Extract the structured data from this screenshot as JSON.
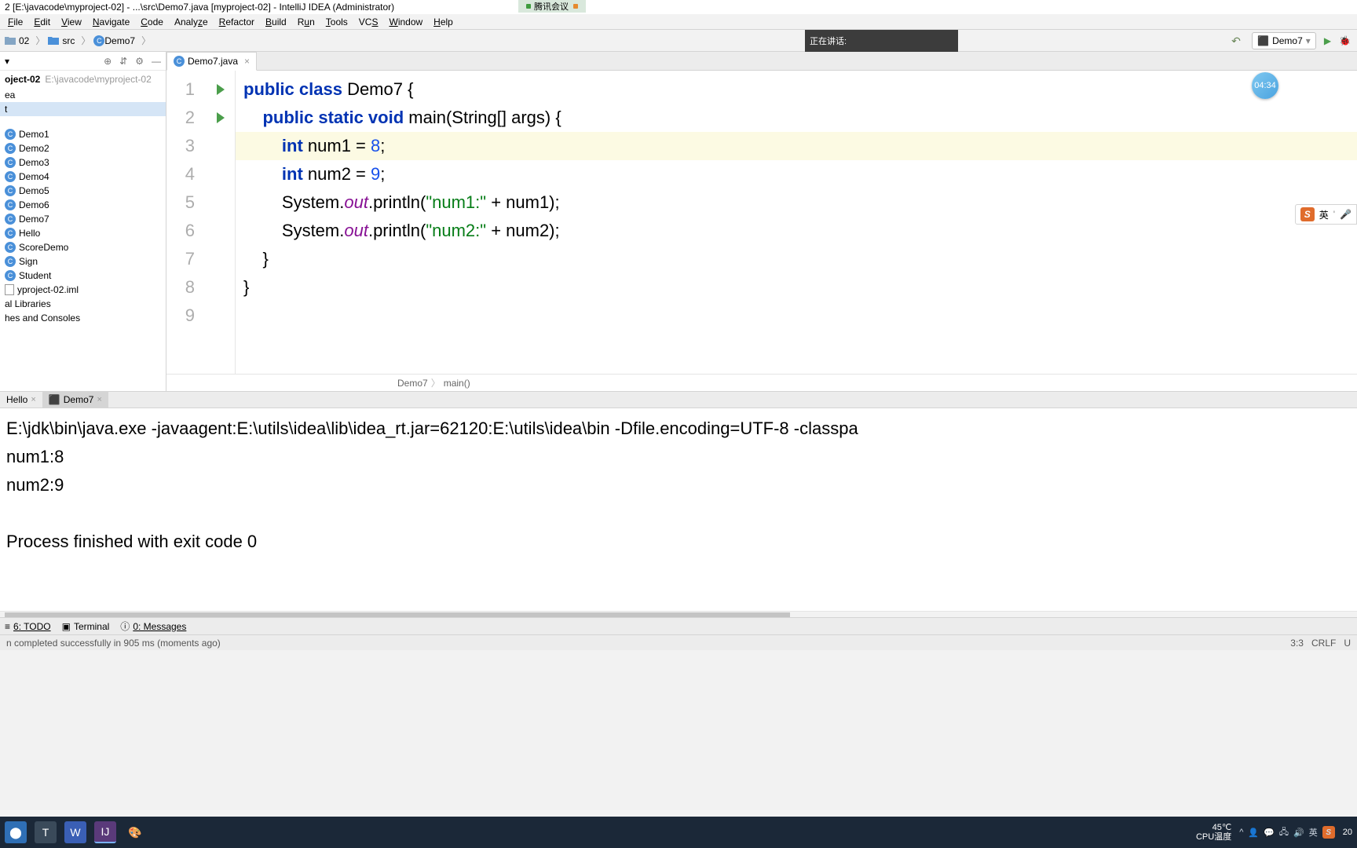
{
  "title_bar": {
    "title": "2 [E:\\javacode\\myproject-02] - ...\\src\\Demo7.java [myproject-02] - IntelliJ IDEA (Administrator)",
    "tencent": "腾讯会议"
  },
  "menu": {
    "file": "File",
    "edit": "Edit",
    "view": "View",
    "navigate": "Navigate",
    "code": "Code",
    "analyze": "Analyze",
    "refactor": "Refactor",
    "build": "Build",
    "run": "Run",
    "tools": "Tools",
    "vcs": "VCS",
    "window": "Window",
    "help": "Help"
  },
  "nav": {
    "crumb1": "02",
    "crumb2": "src",
    "crumb3": "Demo7",
    "talking": "正在讲话:",
    "run_config": "Demo7"
  },
  "sidebar": {
    "header_name": "oject-02",
    "header_path": "E:\\javacode\\myproject-02",
    "item_ea": "ea",
    "item_t": "t",
    "files": [
      "Demo1",
      "Demo2",
      "Demo3",
      "Demo4",
      "Demo5",
      "Demo6",
      "Demo7",
      "Hello",
      "ScoreDemo",
      "Sign",
      "Student"
    ],
    "iml": "yproject-02.iml",
    "libs": "al Libraries",
    "scratch": "hes and Consoles"
  },
  "tab": {
    "name": "Demo7.java"
  },
  "code": {
    "l1a": "public ",
    "l1b": "class ",
    "l1c": "Demo7 ",
    "l1d": "{",
    "l2a": "    public static void ",
    "l2b": "main",
    "l2c": "(String[] args) {",
    "l3a": "        int ",
    "l3b": "num1 = ",
    "l3c": "8",
    "l3d": ";",
    "l4a": "        int ",
    "l4b": "num2 = ",
    "l4c": "9",
    "l4d": ";",
    "l5a": "        System.",
    "l5b": "out",
    "l5c": ".println(",
    "l5d": "\"num1:\"",
    "l5e": " + num1);",
    "l6a": "        System.",
    "l6b": "out",
    "l6c": ".println(",
    "l6d": "\"num2:\"",
    "l6e": " + num2);",
    "l7": "    }",
    "l8": "}",
    "gutter": [
      "1",
      "2",
      "3",
      "4",
      "5",
      "6",
      "7",
      "8",
      "9"
    ]
  },
  "crumb_bottom": {
    "cls": "Demo7",
    "method": "main()"
  },
  "run_tabs": {
    "hello": "Hello",
    "demo7": "Demo7"
  },
  "console": {
    "cmd": "E:\\jdk\\bin\\java.exe -javaagent:E:\\utils\\idea\\lib\\idea_rt.jar=62120:E:\\utils\\idea\\bin -Dfile.encoding=UTF-8 -classpa",
    "out1": "num1:8",
    "out2": "num2:9",
    "exit": "Process finished with exit code 0"
  },
  "bottom_tabs": {
    "todo": "6: TODO",
    "terminal": "Terminal",
    "messages": "0: Messages"
  },
  "status_bar": {
    "msg": "n completed successfully in 905 ms (moments ago)",
    "pos": "3:3",
    "crlf": "CRLF",
    "enc": "U"
  },
  "timer": "04:34",
  "ime": "英",
  "taskbar": {
    "temp": "45℃",
    "cpu": "CPU温度",
    "time": "20"
  }
}
